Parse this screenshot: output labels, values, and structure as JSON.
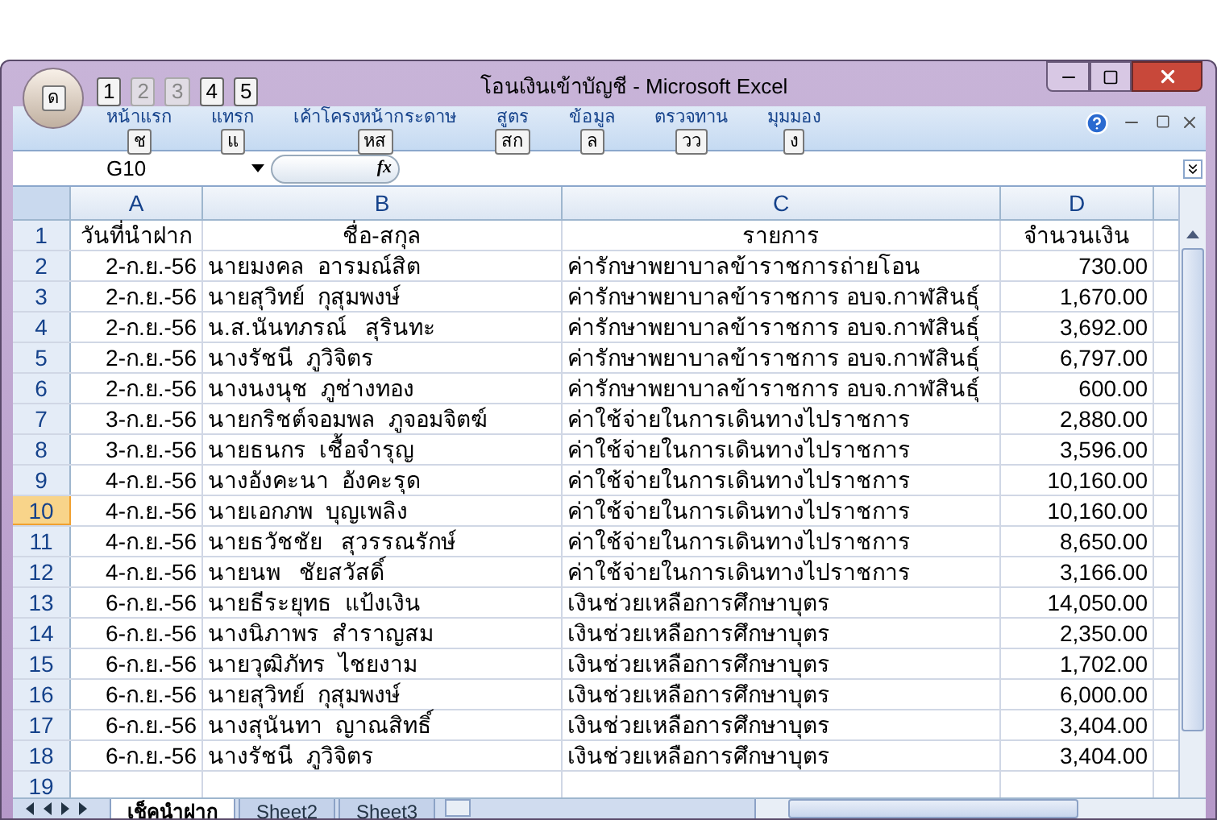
{
  "window": {
    "title": "โอนเงินเข้าบัญชี - Microsoft Excel"
  },
  "office_button": {
    "keytip": "ด"
  },
  "quick_access": [
    {
      "keytip": "1",
      "disabled": false
    },
    {
      "keytip": "2",
      "disabled": true
    },
    {
      "keytip": "3",
      "disabled": true
    },
    {
      "keytip": "4",
      "disabled": false
    },
    {
      "keytip": "5",
      "disabled": false
    }
  ],
  "ribbon_tabs": [
    {
      "label": "หน้าแรก",
      "keytip": "ช"
    },
    {
      "label": "แทรก",
      "keytip": "แ"
    },
    {
      "label": "เค้าโครงหน้ากระดาษ",
      "keytip": "หส"
    },
    {
      "label": "สูตร",
      "keytip": "สก"
    },
    {
      "label": "ข้อมูล",
      "keytip": "ล"
    },
    {
      "label": "ตรวจทาน",
      "keytip": "วว"
    },
    {
      "label": "มุมมอง",
      "keytip": "ง"
    }
  ],
  "name_box": "G10",
  "function_button": "fx",
  "columns": [
    "A",
    "B",
    "C",
    "D"
  ],
  "rows": [
    {
      "num": "1",
      "selected": false,
      "cells": [
        "วันที่นำฝาก",
        "ชื่อ-สกุล",
        "รายการ",
        "จำนวนเงิน"
      ],
      "kind": "header"
    },
    {
      "num": "2",
      "selected": false,
      "cells": [
        "2-ก.ย.-56",
        "นายมงคล  อารมณ์สิต",
        "ค่ารักษาพยาบาลข้าราชการถ่ายโอน",
        "730.00"
      ],
      "kind": "data"
    },
    {
      "num": "3",
      "selected": false,
      "cells": [
        "2-ก.ย.-56",
        "นายสุวิทย์  กุสุมพงษ์",
        "ค่ารักษาพยาบาลข้าราชการ อบจ.กาฬสินธุ์",
        "1,670.00"
      ],
      "kind": "data"
    },
    {
      "num": "4",
      "selected": false,
      "cells": [
        "2-ก.ย.-56",
        "น.ส.นันทภรณ์   สุรินทะ",
        "ค่ารักษาพยาบาลข้าราชการ อบจ.กาฬสินธุ์",
        "3,692.00"
      ],
      "kind": "data"
    },
    {
      "num": "5",
      "selected": false,
      "cells": [
        "2-ก.ย.-56",
        "นางรัชนี  ภูวิจิตร",
        "ค่ารักษาพยาบาลข้าราชการ อบจ.กาฬสินธุ์",
        "6,797.00"
      ],
      "kind": "data"
    },
    {
      "num": "6",
      "selected": false,
      "cells": [
        "2-ก.ย.-56",
        "นางนงนุช  ภูช่างทอง",
        "ค่ารักษาพยาบาลข้าราชการ อบจ.กาฬสินธุ์",
        "600.00"
      ],
      "kind": "data"
    },
    {
      "num": "7",
      "selected": false,
      "cells": [
        "3-ก.ย.-56",
        "นายกริชต์จอมพล  ภูจอมจิตฆ์",
        "ค่าใช้จ่ายในการเดินทางไปราชการ",
        "2,880.00"
      ],
      "kind": "data"
    },
    {
      "num": "8",
      "selected": false,
      "cells": [
        "3-ก.ย.-56",
        "นายธนกร  เชื้อจำรุญ",
        "ค่าใช้จ่ายในการเดินทางไปราชการ",
        "3,596.00"
      ],
      "kind": "data"
    },
    {
      "num": "9",
      "selected": false,
      "cells": [
        "4-ก.ย.-56",
        "นางอังคะนา  อังคะรุด",
        "ค่าใช้จ่ายในการเดินทางไปราชการ",
        "10,160.00"
      ],
      "kind": "data"
    },
    {
      "num": "10",
      "selected": true,
      "cells": [
        "4-ก.ย.-56",
        "นายเอกภพ  บุญเพลิง",
        "ค่าใช้จ่ายในการเดินทางไปราชการ",
        "10,160.00"
      ],
      "kind": "data"
    },
    {
      "num": "11",
      "selected": false,
      "cells": [
        "4-ก.ย.-56",
        "นายธวัชชัย   สุวรรณรักษ์",
        "ค่าใช้จ่ายในการเดินทางไปราชการ",
        "8,650.00"
      ],
      "kind": "data"
    },
    {
      "num": "12",
      "selected": false,
      "cells": [
        "4-ก.ย.-56",
        "นายนพ   ชัยสวัสดิ์",
        "ค่าใช้จ่ายในการเดินทางไปราชการ",
        "3,166.00"
      ],
      "kind": "data"
    },
    {
      "num": "13",
      "selected": false,
      "cells": [
        "6-ก.ย.-56",
        "นายธีระยุทธ  แป้งเงิน",
        "เงินช่วยเหลือการศึกษาบุตร",
        "14,050.00"
      ],
      "kind": "data"
    },
    {
      "num": "14",
      "selected": false,
      "cells": [
        "6-ก.ย.-56",
        "นางนิภาพร  สำราญสม",
        "เงินช่วยเหลือการศึกษาบุตร",
        "2,350.00"
      ],
      "kind": "data"
    },
    {
      "num": "15",
      "selected": false,
      "cells": [
        "6-ก.ย.-56",
        "นายวุฒิภัทร  ไชยงาม",
        "เงินช่วยเหลือการศึกษาบุตร",
        "1,702.00"
      ],
      "kind": "data"
    },
    {
      "num": "16",
      "selected": false,
      "cells": [
        "6-ก.ย.-56",
        "นายสุวิทย์  กุสุมพงษ์",
        "เงินช่วยเหลือการศึกษาบุตร",
        "6,000.00"
      ],
      "kind": "data"
    },
    {
      "num": "17",
      "selected": false,
      "cells": [
        "6-ก.ย.-56",
        "นางสุนันทา  ญาณสิทธิ์",
        "เงินช่วยเหลือการศึกษาบุตร",
        "3,404.00"
      ],
      "kind": "data"
    },
    {
      "num": "18",
      "selected": false,
      "cells": [
        "6-ก.ย.-56",
        "นางรัชนี  ภูวิจิตร",
        "เงินช่วยเหลือการศึกษาบุตร",
        "3,404.00"
      ],
      "kind": "data"
    },
    {
      "num": "19",
      "selected": false,
      "cells": [],
      "kind": "empty"
    }
  ],
  "sheet_tabs": [
    {
      "label": "เช็คนำฝาก",
      "selected": true
    },
    {
      "label": "Sheet2",
      "selected": false
    },
    {
      "label": "Sheet3",
      "selected": false
    }
  ]
}
